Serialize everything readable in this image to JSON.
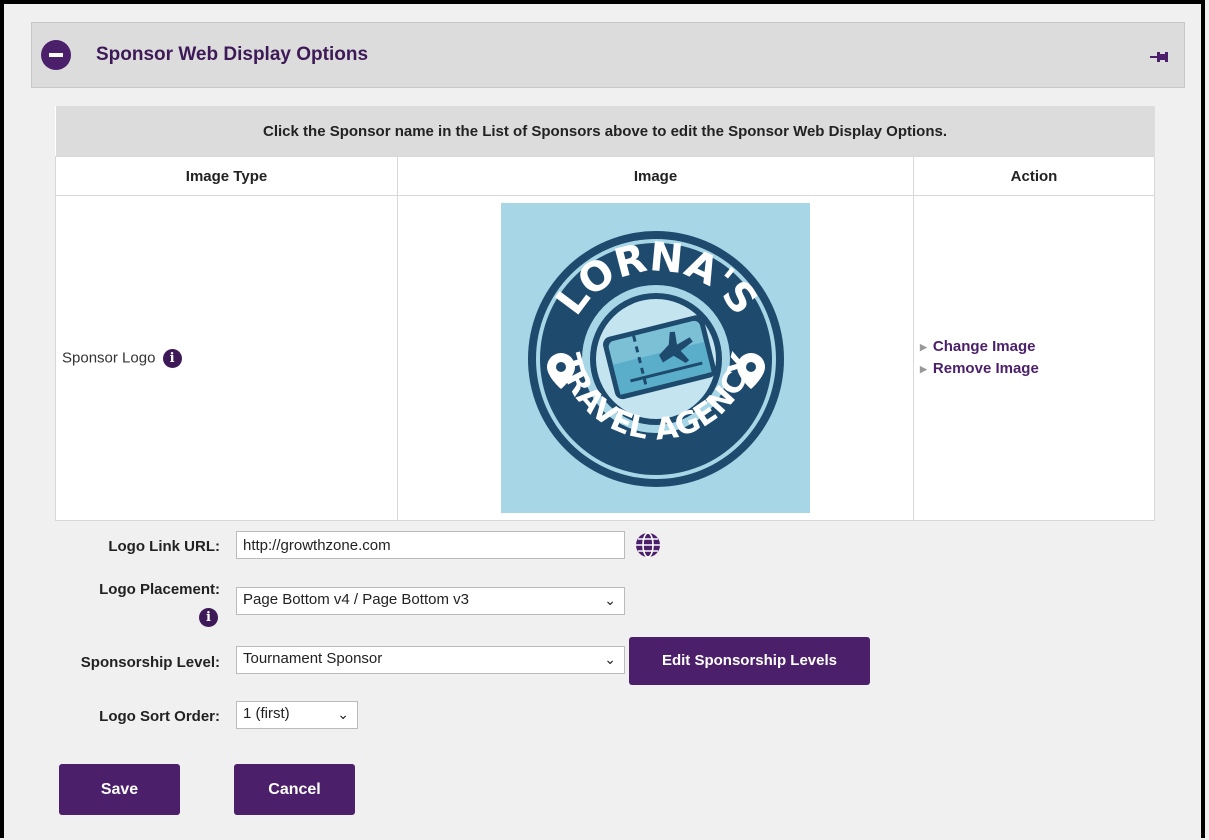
{
  "panel": {
    "title": "Sponsor Web Display Options"
  },
  "table": {
    "note": "Click the Sponsor name in the List of Sponsors above to edit the Sponsor Web Display Options.",
    "headers": [
      "Image Type",
      "Image",
      "Action"
    ],
    "row": {
      "image_type": "Sponsor Logo",
      "logo_text_top": "LORNA'S",
      "logo_text_bottom": "TRAVEL AGENCY",
      "actions": [
        "Change Image",
        "Remove Image"
      ]
    }
  },
  "form": {
    "logo_link_label": "Logo Link URL:",
    "logo_link_value": "http://growthzone.com",
    "placement_label": "Logo Placement:",
    "placement_value": "Page Bottom v4 / Page Bottom v3",
    "level_label": "Sponsorship Level:",
    "level_value": "Tournament Sponsor",
    "edit_levels_button": "Edit Sponsorship Levels",
    "sort_label": "Logo Sort Order:",
    "sort_value": "1 (first)"
  },
  "buttons": {
    "save": "Save",
    "cancel": "Cancel"
  },
  "colors": {
    "accent": "#4b1f6a",
    "logo_background": "#a7d6e6",
    "logo_navy": "#1d4a6d"
  },
  "icons": [
    "collapse-icon",
    "pin-icon",
    "info-icon",
    "globe-icon",
    "chevron-down-icon"
  ]
}
